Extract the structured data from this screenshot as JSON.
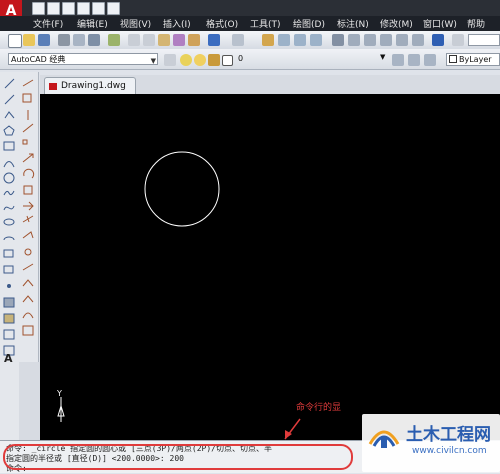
{
  "app": {
    "logo": "A"
  },
  "menu": [
    "文件(F)",
    "编辑(E)",
    "视图(V)",
    "插入(I)",
    "格式(O)",
    "工具(T)",
    "绘图(D)",
    "标注(N)",
    "修改(M)",
    "窗口(W)",
    "帮助"
  ],
  "toolbar": {
    "workspace": "AutoCAD 经典",
    "layer": "0",
    "linetype": "ByLayer"
  },
  "document": {
    "tab": "Drawing1.dwg"
  },
  "canvas": {
    "ucs_label": "Y"
  },
  "command": {
    "line1": "命令: _circle 指定圆的圆心或 [三点(3P)/两点(2P)/切点、切点、半",
    "line2": "指定圆的半径或 [直径(D)] <200.0000>: 200",
    "line3": "命令:"
  },
  "annotation": "命令行的显",
  "watermark": {
    "title": "土木工程网",
    "url": "www.civilcn.com"
  },
  "colors": {
    "accent_red": "#e03b3b",
    "canvas": "#000000"
  }
}
